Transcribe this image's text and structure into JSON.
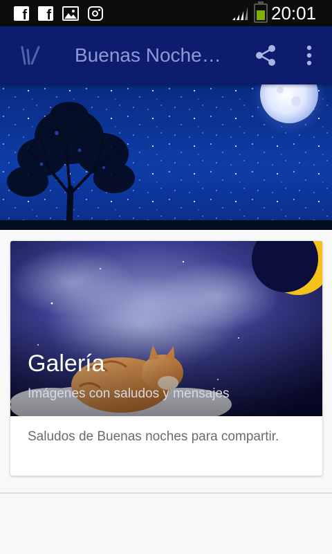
{
  "status_bar": {
    "time": "20:01",
    "icons": [
      "facebook-icon",
      "facebook-icon",
      "gallery-icon",
      "instagram-icon",
      "signal-icon",
      "battery-icon"
    ],
    "battery_color": "#7fb000"
  },
  "toolbar": {
    "title": "Buenas Noches Amor",
    "logo_icon": "app-logo-icon",
    "share_icon": "share-icon",
    "more_icon": "more-vertical-icon",
    "background": "#0e1c6e"
  },
  "card": {
    "title": "Galería",
    "subtitle": "Imágenes con saludos y mensajes",
    "text": "Saludos de Buenas noches para compartir."
  }
}
